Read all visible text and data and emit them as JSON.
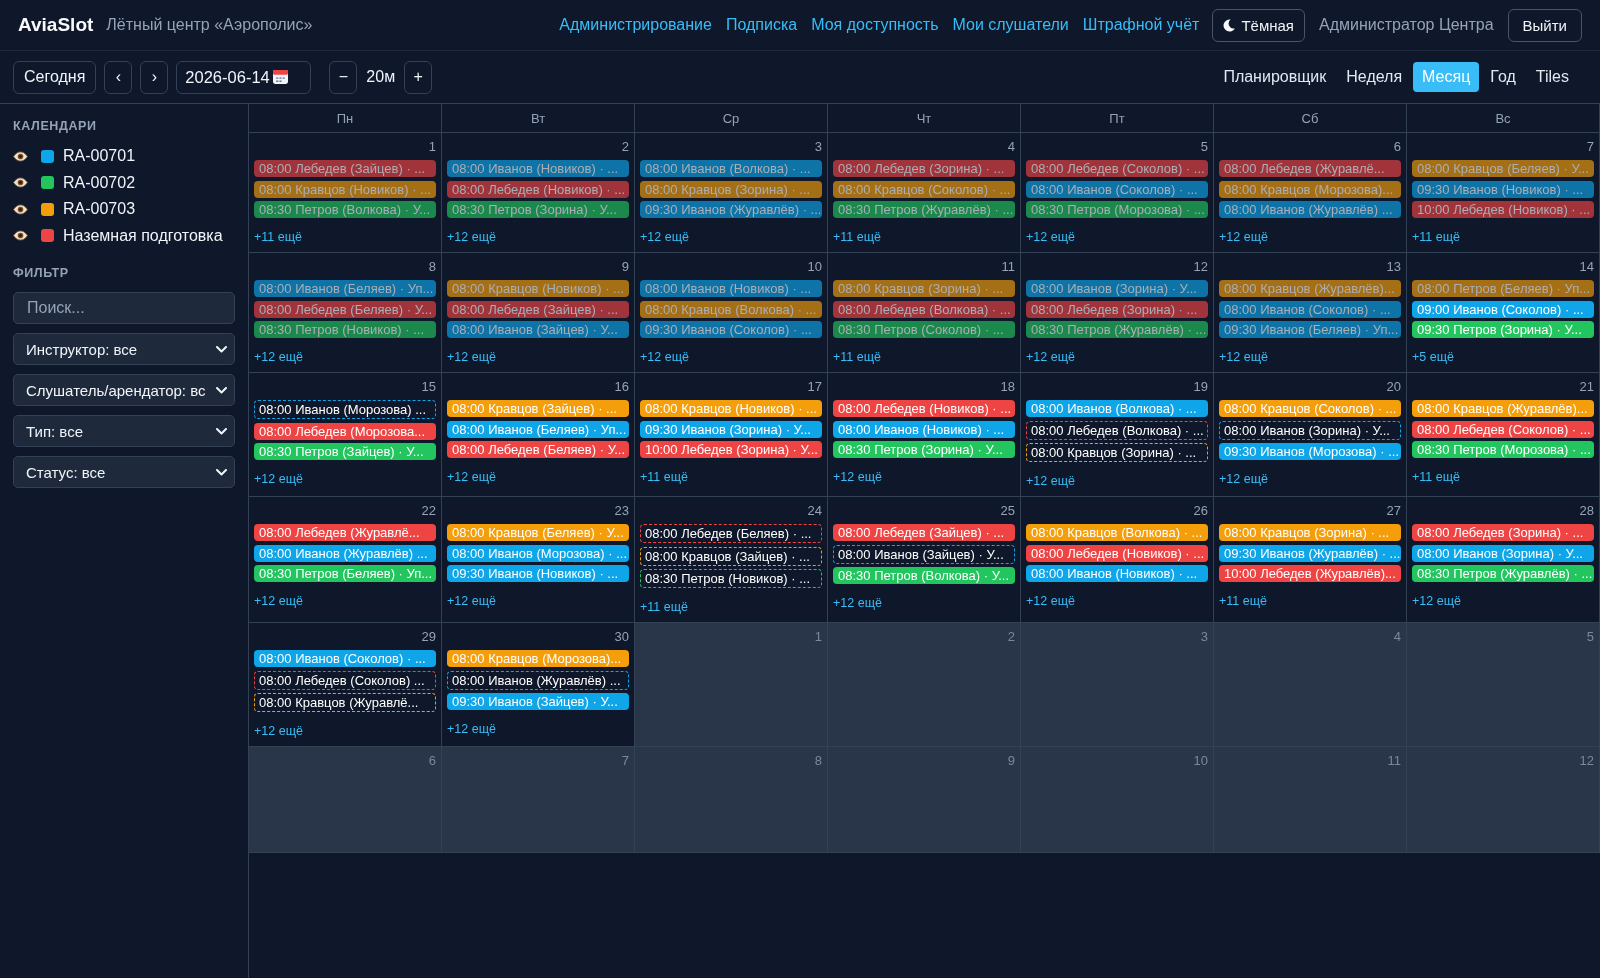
{
  "header": {
    "logo": "AviaSlot",
    "subtitle": "Лётный центр «Аэрополис»",
    "nav": [
      "Администрирование",
      "Подписка",
      "Моя доступность",
      "Мои слушатели",
      "Штрафной учёт"
    ],
    "theme_button": "Тёмная",
    "user": "Администратор Центра",
    "logout": "Выйти"
  },
  "toolbar": {
    "today": "Сегодня",
    "prev": "‹",
    "next": "›",
    "date": "2026-06-14",
    "zoom_out": "−",
    "zoom": "20м",
    "zoom_in": "+",
    "views": [
      {
        "label": "Планировщик",
        "selected": false
      },
      {
        "label": "Неделя",
        "selected": false
      },
      {
        "label": "Месяц",
        "selected": true
      },
      {
        "label": "Год",
        "selected": false
      },
      {
        "label": "Tiles",
        "selected": false
      }
    ]
  },
  "sidebar": {
    "calendars_title": "КАЛЕНДАРИ",
    "calendars": [
      {
        "name": "RA-00701",
        "color": "#0ea5e9",
        "visible": true
      },
      {
        "name": "RA-00702",
        "color": "#22c55e",
        "visible": true
      },
      {
        "name": "RA-00703",
        "color": "#f59e0b",
        "visible": true
      },
      {
        "name": "Наземная подготовка",
        "color": "#ef4444",
        "visible": true
      }
    ],
    "filter_title": "ФИЛЬТР",
    "search": {
      "placeholder": "Поиск..."
    },
    "selects": [
      "Инструктор: все",
      "Слушатель/арендатор: вс",
      "Тип: все",
      "Статус: все"
    ]
  },
  "calendar": {
    "weekdays": [
      "Пн",
      "Вт",
      "Ср",
      "Чт",
      "Пт",
      "Сб",
      "Вс"
    ],
    "weeks": [
      {
        "days": [
          {
            "day": "1",
            "outside": false,
            "more": "+11 ещё",
            "events": [
              {
                "text": "08:00 Лебедев (Зайцев) · ...",
                "color": "#a1343b",
                "kind": "solid",
                "past": true
              },
              {
                "text": "08:00 Кравцов (Новиков) · ...",
                "color": "#a56f16",
                "kind": "solid",
                "past": true
              },
              {
                "text": "08:30 Петров (Волкова) · У...",
                "color": "#1b884c",
                "kind": "solid",
                "past": true
              }
            ]
          },
          {
            "day": "2",
            "outside": false,
            "more": "+12 ещё",
            "events": [
              {
                "text": "08:00 Иванов (Новиков) · ...",
                "color": "#0e73a6",
                "kind": "solid",
                "past": true
              },
              {
                "text": "08:00 Лебедев (Новиков) · ...",
                "color": "#a1343b",
                "kind": "solid",
                "past": true
              },
              {
                "text": "08:30 Петров (Зорина) · У...",
                "color": "#1b884c",
                "kind": "solid",
                "past": true
              }
            ]
          },
          {
            "day": "3",
            "outside": false,
            "more": "+12 ещё",
            "events": [
              {
                "text": "08:00 Иванов (Волкова) · ...",
                "color": "#0e73a6",
                "kind": "solid",
                "past": true
              },
              {
                "text": "08:00 Кравцов (Зорина) · ...",
                "color": "#a56f16",
                "kind": "solid",
                "past": true
              },
              {
                "text": "09:30 Иванов (Журавлёв) · ...",
                "color": "#0e73a6",
                "kind": "solid",
                "past": true
              }
            ]
          },
          {
            "day": "4",
            "outside": false,
            "more": "+11 ещё",
            "events": [
              {
                "text": "08:00 Лебедев (Зорина) · ...",
                "color": "#a1343b",
                "kind": "solid",
                "past": true
              },
              {
                "text": "08:00 Кравцов (Соколов) · ...",
                "color": "#a56f16",
                "kind": "solid",
                "past": true
              },
              {
                "text": "08:30 Петров (Журавлёв) · ...",
                "color": "#1b884c",
                "kind": "solid",
                "past": true
              }
            ]
          },
          {
            "day": "5",
            "outside": false,
            "more": "+12 ещё",
            "events": [
              {
                "text": "08:00 Лебедев (Соколов) · ...",
                "color": "#a1343b",
                "kind": "solid",
                "past": true
              },
              {
                "text": "08:00 Иванов (Соколов) · ...",
                "color": "#0e73a6",
                "kind": "solid",
                "past": true
              },
              {
                "text": "08:30 Петров (Морозова) · ...",
                "color": "#1b884c",
                "kind": "solid",
                "past": true
              }
            ]
          },
          {
            "day": "6",
            "outside": false,
            "more": "+12 ещё",
            "events": [
              {
                "text": "08:00 Лебедев (Журавлё...",
                "color": "#a1343b",
                "kind": "solid",
                "past": true
              },
              {
                "text": "08:00 Кравцов (Морозова)...",
                "color": "#a56f16",
                "kind": "solid",
                "past": true
              },
              {
                "text": "08:00 Иванов (Журавлёв) ...",
                "color": "#0e73a6",
                "kind": "solid",
                "past": true
              }
            ]
          },
          {
            "day": "7",
            "outside": false,
            "more": "+11 ещё",
            "events": [
              {
                "text": "08:00 Кравцов (Беляев) · У...",
                "color": "#a56f16",
                "kind": "solid",
                "past": true
              },
              {
                "text": "09:30 Иванов (Новиков) · ...",
                "color": "#0e73a6",
                "kind": "solid",
                "past": true
              },
              {
                "text": "10:00 Лебедев (Новиков) · ...",
                "color": "#a1343b",
                "kind": "solid",
                "past": true
              }
            ]
          }
        ]
      },
      {
        "days": [
          {
            "day": "8",
            "outside": false,
            "more": "+12 ещё",
            "events": [
              {
                "text": "08:00 Иванов (Беляев) · Уп...",
                "color": "#0e73a6",
                "kind": "solid",
                "past": true
              },
              {
                "text": "08:00 Лебедев (Беляев) · У...",
                "color": "#a1343b",
                "kind": "solid",
                "past": true
              },
              {
                "text": "08:30 Петров (Новиков) · ...",
                "color": "#1b884c",
                "kind": "solid",
                "past": true
              }
            ]
          },
          {
            "day": "9",
            "outside": false,
            "more": "+12 ещё",
            "events": [
              {
                "text": "08:00 Кравцов (Новиков) · ...",
                "color": "#a56f16",
                "kind": "solid",
                "past": true
              },
              {
                "text": "08:00 Лебедев (Зайцев) · ...",
                "color": "#a1343b",
                "kind": "solid",
                "past": true
              },
              {
                "text": "08:00 Иванов (Зайцев) · У...",
                "color": "#0e73a6",
                "kind": "solid",
                "past": true
              }
            ]
          },
          {
            "day": "10",
            "outside": false,
            "more": "+12 ещё",
            "events": [
              {
                "text": "08:00 Иванов (Новиков) · ...",
                "color": "#0e73a6",
                "kind": "solid",
                "past": true
              },
              {
                "text": "08:00 Кравцов (Волкова) · ...",
                "color": "#a56f16",
                "kind": "solid",
                "past": true
              },
              {
                "text": "09:30 Иванов (Соколов) · ...",
                "color": "#0e73a6",
                "kind": "solid",
                "past": true
              }
            ]
          },
          {
            "day": "11",
            "outside": false,
            "more": "+11 ещё",
            "events": [
              {
                "text": "08:00 Кравцов (Зорина) · ...",
                "color": "#a56f16",
                "kind": "solid",
                "past": true
              },
              {
                "text": "08:00 Лебедев (Волкова) · ...",
                "color": "#a1343b",
                "kind": "solid",
                "past": true
              },
              {
                "text": "08:30 Петров (Соколов) · ...",
                "color": "#1b884c",
                "kind": "solid",
                "past": true
              }
            ]
          },
          {
            "day": "12",
            "outside": false,
            "more": "+12 ещё",
            "events": [
              {
                "text": "08:00 Иванов (Зорина) · У...",
                "color": "#0e73a6",
                "kind": "solid",
                "past": true
              },
              {
                "text": "08:00 Лебедев (Зорина) · ...",
                "color": "#a1343b",
                "kind": "solid",
                "past": true
              },
              {
                "text": "08:30 Петров (Журавлёв) · ...",
                "color": "#1b884c",
                "kind": "solid",
                "past": true
              }
            ]
          },
          {
            "day": "13",
            "outside": false,
            "more": "+12 ещё",
            "events": [
              {
                "text": "08:00 Кравцов (Журавлёв)...",
                "color": "#a56f16",
                "kind": "solid",
                "past": true
              },
              {
                "text": "08:00 Иванов (Соколов) · ...",
                "color": "#0e73a6",
                "kind": "solid",
                "past": true
              },
              {
                "text": "09:30 Иванов (Беляев) · Уп...",
                "color": "#0e73a6",
                "kind": "solid",
                "past": true
              }
            ]
          },
          {
            "day": "14",
            "outside": false,
            "more": "+5 ещё",
            "events": [
              {
                "text": "08:00 Петров (Беляев) · Уп...",
                "color": "#a56f16",
                "kind": "solid",
                "past": true
              },
              {
                "text": "09:00 Иванов (Соколов) · ...",
                "color": "#0ea5e9",
                "kind": "solid",
                "past": false
              },
              {
                "text": "09:30 Петров (Зорина) · У...",
                "color": "#22c55e",
                "kind": "solid",
                "past": false
              }
            ]
          }
        ]
      },
      {
        "days": [
          {
            "day": "15",
            "outside": false,
            "more": "+12 ещё",
            "events": [
              {
                "text": "08:00 Иванов (Морозова) ...",
                "color": "#0ea5e9",
                "kind": "dashed",
                "past": false
              },
              {
                "text": "08:00 Лебедев (Морозова...",
                "color": "#ef4444",
                "kind": "solid",
                "past": false
              },
              {
                "text": "08:30 Петров (Зайцев) · У...",
                "color": "#22c55e",
                "kind": "solid",
                "past": false
              }
            ]
          },
          {
            "day": "16",
            "outside": false,
            "more": "+12 ещё",
            "events": [
              {
                "text": "08:00 Кравцов (Зайцев) · ...",
                "color": "#f59e0b",
                "kind": "solid",
                "past": false
              },
              {
                "text": "08:00 Иванов (Беляев) · Уп...",
                "color": "#0ea5e9",
                "kind": "solid",
                "past": false
              },
              {
                "text": "08:00 Лебедев (Беляев) · У...",
                "color": "#ef4444",
                "kind": "solid",
                "past": false
              }
            ]
          },
          {
            "day": "17",
            "outside": false,
            "more": "+11 ещё",
            "events": [
              {
                "text": "08:00 Кравцов (Новиков) · ...",
                "color": "#f59e0b",
                "kind": "solid",
                "past": false
              },
              {
                "text": "09:30 Иванов (Зорина) · У...",
                "color": "#0ea5e9",
                "kind": "solid",
                "past": false
              },
              {
                "text": "10:00 Лебедев (Зорина) · У...",
                "color": "#ef4444",
                "kind": "solid",
                "past": false
              }
            ]
          },
          {
            "day": "18",
            "outside": false,
            "more": "+12 ещё",
            "events": [
              {
                "text": "08:00 Лебедев (Новиков) · ...",
                "color": "#ef4444",
                "kind": "solid",
                "past": false
              },
              {
                "text": "08:00 Иванов (Новиков) · ...",
                "color": "#0ea5e9",
                "kind": "solid",
                "past": false
              },
              {
                "text": "08:30 Петров (Зорина) · У...",
                "color": "#22c55e",
                "kind": "solid",
                "past": false
              }
            ]
          },
          {
            "day": "19",
            "outside": false,
            "more": "+12 ещё",
            "events": [
              {
                "text": "08:00 Иванов (Волкова) · ...",
                "color": "#0ea5e9",
                "kind": "solid",
                "past": false
              },
              {
                "text": "08:00 Лебедев (Волкова) · ...",
                "color": "#ef4444",
                "kind": "dashed",
                "past": false
              },
              {
                "text": "08:00 Кравцов (Зорина) · ...",
                "color": "#f59e0b",
                "kind": "dashed",
                "past": false
              }
            ]
          },
          {
            "day": "20",
            "outside": false,
            "more": "+12 ещё",
            "events": [
              {
                "text": "08:00 Кравцов (Соколов) · ...",
                "color": "#f59e0b",
                "kind": "solid",
                "past": false
              },
              {
                "text": "08:00 Иванов (Зорина) · У...",
                "color": "#0ea5e9",
                "kind": "dashed",
                "past": false
              },
              {
                "text": "09:30 Иванов (Морозова) · ...",
                "color": "#0ea5e9",
                "kind": "solid",
                "past": false
              }
            ]
          },
          {
            "day": "21",
            "outside": false,
            "more": "+11 ещё",
            "events": [
              {
                "text": "08:00 Кравцов (Журавлёв)...",
                "color": "#f59e0b",
                "kind": "solid",
                "past": false
              },
              {
                "text": "08:00 Лебедев (Соколов) · ...",
                "color": "#ef4444",
                "kind": "solid",
                "past": false
              },
              {
                "text": "08:30 Петров (Морозова) · ...",
                "color": "#22c55e",
                "kind": "solid",
                "past": false
              }
            ]
          }
        ]
      },
      {
        "days": [
          {
            "day": "22",
            "outside": false,
            "more": "+12 ещё",
            "events": [
              {
                "text": "08:00 Лебедев (Журавлё...",
                "color": "#ef4444",
                "kind": "solid",
                "past": false
              },
              {
                "text": "08:00 Иванов (Журавлёв) ...",
                "color": "#0ea5e9",
                "kind": "solid",
                "past": false
              },
              {
                "text": "08:30 Петров (Беляев) · Уп...",
                "color": "#22c55e",
                "kind": "solid",
                "past": false
              }
            ]
          },
          {
            "day": "23",
            "outside": false,
            "more": "+12 ещё",
            "events": [
              {
                "text": "08:00 Кравцов (Беляев) · У...",
                "color": "#f59e0b",
                "kind": "solid",
                "past": false
              },
              {
                "text": "08:00 Иванов (Морозова) · ...",
                "color": "#0ea5e9",
                "kind": "solid",
                "past": false
              },
              {
                "text": "09:30 Иванов (Новиков) · ...",
                "color": "#0ea5e9",
                "kind": "solid",
                "past": false
              }
            ]
          },
          {
            "day": "24",
            "outside": false,
            "more": "+11 ещё",
            "events": [
              {
                "text": "08:00 Лебедев (Беляев) · ...",
                "color": "#ef4444",
                "kind": "dashed",
                "past": false
              },
              {
                "text": "08:00 Кравцов (Зайцев) · ...",
                "color": "#f59e0b",
                "kind": "dashed",
                "past": false
              },
              {
                "text": "08:30 Петров (Новиков) · ...",
                "color": "#22c55e",
                "kind": "dashed",
                "past": false
              }
            ]
          },
          {
            "day": "25",
            "outside": false,
            "more": "+12 ещё",
            "events": [
              {
                "text": "08:00 Лебедев (Зайцев) · ...",
                "color": "#ef4444",
                "kind": "solid",
                "past": false
              },
              {
                "text": "08:00 Иванов (Зайцев) · У...",
                "color": "#0ea5e9",
                "kind": "dashed",
                "past": false
              },
              {
                "text": "08:30 Петров (Волкова) · У...",
                "color": "#22c55e",
                "kind": "solid",
                "past": false
              }
            ]
          },
          {
            "day": "26",
            "outside": false,
            "more": "+12 ещё",
            "events": [
              {
                "text": "08:00 Кравцов (Волкова) · ...",
                "color": "#f59e0b",
                "kind": "solid",
                "past": false
              },
              {
                "text": "08:00 Лебедев (Новиков) · ...",
                "color": "#ef4444",
                "kind": "solid",
                "past": false
              },
              {
                "text": "08:00 Иванов (Новиков) · ...",
                "color": "#0ea5e9",
                "kind": "solid",
                "past": false
              }
            ]
          },
          {
            "day": "27",
            "outside": false,
            "more": "+11 ещё",
            "events": [
              {
                "text": "08:00 Кравцов (Зорина) · ...",
                "color": "#f59e0b",
                "kind": "solid",
                "past": false
              },
              {
                "text": "09:30 Иванов (Журавлёв) · ...",
                "color": "#0ea5e9",
                "kind": "solid",
                "past": false
              },
              {
                "text": "10:00 Лебедев (Журавлёв)...",
                "color": "#ef4444",
                "kind": "solid",
                "past": false
              }
            ]
          },
          {
            "day": "28",
            "outside": false,
            "more": "+12 ещё",
            "events": [
              {
                "text": "08:00 Лебедев (Зорина) · ...",
                "color": "#ef4444",
                "kind": "solid",
                "past": false
              },
              {
                "text": "08:00 Иванов (Зорина) · У...",
                "color": "#0ea5e9",
                "kind": "solid",
                "past": false
              },
              {
                "text": "08:30 Петров (Журавлёв) · ...",
                "color": "#22c55e",
                "kind": "solid",
                "past": false
              }
            ]
          }
        ]
      },
      {
        "days": [
          {
            "day": "29",
            "outside": false,
            "more": "+12 ещё",
            "events": [
              {
                "text": "08:00 Иванов (Соколов) · ...",
                "color": "#0ea5e9",
                "kind": "solid",
                "past": false
              },
              {
                "text": "08:00 Лебедев (Соколов) ...",
                "color": "#ef4444",
                "kind": "dashed",
                "past": false
              },
              {
                "text": "08:00 Кравцов (Журавлё...",
                "color": "#f59e0b",
                "kind": "dashed",
                "past": false
              }
            ]
          },
          {
            "day": "30",
            "outside": false,
            "more": "+12 ещё",
            "events": [
              {
                "text": "08:00 Кравцов (Морозова)...",
                "color": "#f59e0b",
                "kind": "solid",
                "past": false
              },
              {
                "text": "08:00 Иванов (Журавлёв) ...",
                "color": "#0ea5e9",
                "kind": "dashed",
                "past": false
              },
              {
                "text": "09:30 Иванов (Зайцев) · У...",
                "color": "#0ea5e9",
                "kind": "solid",
                "past": false
              }
            ]
          },
          {
            "day": "1",
            "outside": true
          },
          {
            "day": "2",
            "outside": true
          },
          {
            "day": "3",
            "outside": true
          },
          {
            "day": "4",
            "outside": true
          },
          {
            "day": "5",
            "outside": true
          }
        ]
      },
      {
        "days": [
          {
            "day": "6",
            "outside": true
          },
          {
            "day": "7",
            "outside": true
          },
          {
            "day": "8",
            "outside": true
          },
          {
            "day": "9",
            "outside": true
          },
          {
            "day": "10",
            "outside": true
          },
          {
            "day": "11",
            "outside": true
          },
          {
            "day": "12",
            "outside": true
          }
        ]
      }
    ]
  }
}
